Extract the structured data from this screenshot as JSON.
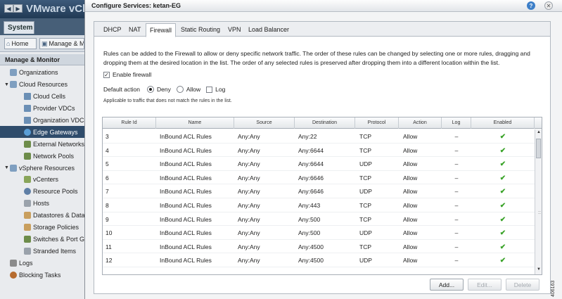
{
  "app": {
    "brand": "VMware vCloud",
    "system_tab": "System",
    "home_label": "Home",
    "manage_label": "Manage & Monitor",
    "sidebar_heading": "Manage & Monitor",
    "tree": [
      {
        "label": "Organizations",
        "icon": "organizations-icon",
        "indent": 0,
        "expander": ""
      },
      {
        "label": "Cloud Resources",
        "icon": "cloud-resources-icon",
        "indent": 0,
        "expander": "▼"
      },
      {
        "label": "Cloud Cells",
        "icon": "cloud-cells-icon",
        "indent": 1,
        "expander": ""
      },
      {
        "label": "Provider VDCs",
        "icon": "provider-vdcs-icon",
        "indent": 1,
        "expander": ""
      },
      {
        "label": "Organization VDCs",
        "icon": "organization-vdcs-icon",
        "indent": 1,
        "expander": ""
      },
      {
        "label": "Edge Gateways",
        "icon": "edge-gateways-icon",
        "indent": 1,
        "expander": "",
        "selected": true
      },
      {
        "label": "External Networks",
        "icon": "external-networks-icon",
        "indent": 1,
        "expander": ""
      },
      {
        "label": "Network Pools",
        "icon": "network-pools-icon",
        "indent": 1,
        "expander": ""
      },
      {
        "label": "vSphere Resources",
        "icon": "vsphere-resources-icon",
        "indent": 0,
        "expander": "▼"
      },
      {
        "label": "vCenters",
        "icon": "vcenters-icon",
        "indent": 1,
        "expander": ""
      },
      {
        "label": "Resource Pools",
        "icon": "resource-pools-icon",
        "indent": 1,
        "expander": ""
      },
      {
        "label": "Hosts",
        "icon": "hosts-icon",
        "indent": 1,
        "expander": ""
      },
      {
        "label": "Datastores & Datast",
        "icon": "datastores-icon",
        "indent": 1,
        "expander": ""
      },
      {
        "label": "Storage Policies",
        "icon": "storage-policies-icon",
        "indent": 1,
        "expander": ""
      },
      {
        "label": "Switches & Port Grou",
        "icon": "switches-icon",
        "indent": 1,
        "expander": ""
      },
      {
        "label": "Stranded Items",
        "icon": "stranded-items-icon",
        "indent": 1,
        "expander": ""
      },
      {
        "label": "Logs",
        "icon": "logs-icon",
        "indent": 0,
        "expander": ""
      },
      {
        "label": "Blocking Tasks",
        "icon": "blocking-tasks-icon",
        "indent": 0,
        "expander": ""
      }
    ]
  },
  "dialog": {
    "title": "Configure Services: ketan-EG",
    "tabs": [
      "DHCP",
      "NAT",
      "Firewall",
      "Static Routing",
      "VPN",
      "Load Balancer"
    ],
    "active_tab": "Firewall",
    "description": "Rules can be added to the Firewall to allow or deny specific network traffic. The order of these rules can be changed by selecting one or more rules, dragging and dropping them at the desired location in the list. The order of any selected rules is preserved after dropping them into a different location within the list.",
    "enable_firewall_label": "Enable firewall",
    "enable_firewall_checked": true,
    "default_action_label": "Default action",
    "deny_label": "Deny",
    "allow_label": "Allow",
    "log_label": "Log",
    "default_action_selected": "Deny",
    "note": "Applicable to traffic that does not match the rules in the list.",
    "columns": [
      "Rule Id",
      "Name",
      "Source",
      "Destination",
      "Protocol",
      "Action",
      "Log",
      "Enabled"
    ],
    "rows": [
      {
        "id": "3",
        "name": "InBound ACL Rules",
        "source": "Any:Any",
        "destination": "Any:22",
        "protocol": "TCP",
        "action": "Allow",
        "log": "–",
        "enabled": "✔"
      },
      {
        "id": "4",
        "name": "InBound ACL Rules",
        "source": "Any:Any",
        "destination": "Any:6644",
        "protocol": "TCP",
        "action": "Allow",
        "log": "–",
        "enabled": "✔"
      },
      {
        "id": "5",
        "name": "InBound ACL Rules",
        "source": "Any:Any",
        "destination": "Any:6644",
        "protocol": "UDP",
        "action": "Allow",
        "log": "–",
        "enabled": "✔"
      },
      {
        "id": "6",
        "name": "InBound ACL Rules",
        "source": "Any:Any",
        "destination": "Any:6646",
        "protocol": "TCP",
        "action": "Allow",
        "log": "–",
        "enabled": "✔"
      },
      {
        "id": "7",
        "name": "InBound ACL Rules",
        "source": "Any:Any",
        "destination": "Any:6646",
        "protocol": "UDP",
        "action": "Allow",
        "log": "–",
        "enabled": "✔"
      },
      {
        "id": "8",
        "name": "InBound ACL Rules",
        "source": "Any:Any",
        "destination": "Any:443",
        "protocol": "TCP",
        "action": "Allow",
        "log": "–",
        "enabled": "✔"
      },
      {
        "id": "9",
        "name": "InBound ACL Rules",
        "source": "Any:Any",
        "destination": "Any:500",
        "protocol": "TCP",
        "action": "Allow",
        "log": "–",
        "enabled": "✔"
      },
      {
        "id": "10",
        "name": "InBound ACL Rules",
        "source": "Any:Any",
        "destination": "Any:500",
        "protocol": "UDP",
        "action": "Allow",
        "log": "–",
        "enabled": "✔"
      },
      {
        "id": "11",
        "name": "InBound ACL Rules",
        "source": "Any:Any",
        "destination": "Any:4500",
        "protocol": "TCP",
        "action": "Allow",
        "log": "–",
        "enabled": "✔"
      },
      {
        "id": "12",
        "name": "InBound ACL Rules",
        "source": "Any:Any",
        "destination": "Any:4500",
        "protocol": "UDP",
        "action": "Allow",
        "log": "–",
        "enabled": "✔"
      }
    ],
    "buttons": {
      "add": "Add...",
      "edit": "Edit...",
      "delete": "Delete"
    },
    "figure_id": "406163"
  },
  "colors": {
    "selected_nav": "#2f4c6b",
    "enabled_check": "#3aa329",
    "help": "#3d7fc8"
  }
}
